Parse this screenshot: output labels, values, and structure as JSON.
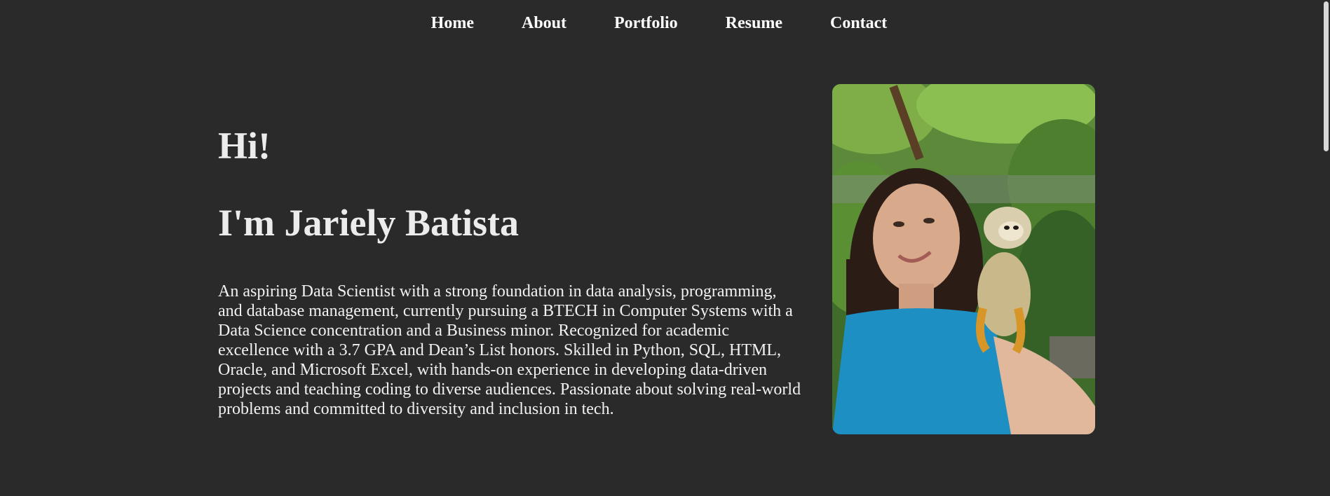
{
  "nav": {
    "items": [
      {
        "label": "Home"
      },
      {
        "label": "About"
      },
      {
        "label": "Portfolio"
      },
      {
        "label": "Resume"
      },
      {
        "label": "Contact"
      }
    ]
  },
  "hero": {
    "greeting": "Hi!",
    "name": "I'm Jariely Batista",
    "bio": "An aspiring Data Scientist with a strong foundation in data analysis, programming, and database management, currently pursuing a BTECH in Computer Systems with a Data Science concentration and a Business minor. Recognized for academic excellence with a 3.7 GPA and Dean’s List honors. Skilled in Python, SQL, HTML, Oracle, and Microsoft Excel, with hands-on experience in developing data-driven projects and teaching coding to diverse audiences. Passionate about solving real-world problems and committed to diversity and inclusion in tech."
  },
  "photo": {
    "alt": "Jariely Batista with a squirrel monkey on her shoulder"
  },
  "colors": {
    "background": "#2a2a2a",
    "text": "#f2f2f2",
    "nav_text": "#ffffff"
  }
}
